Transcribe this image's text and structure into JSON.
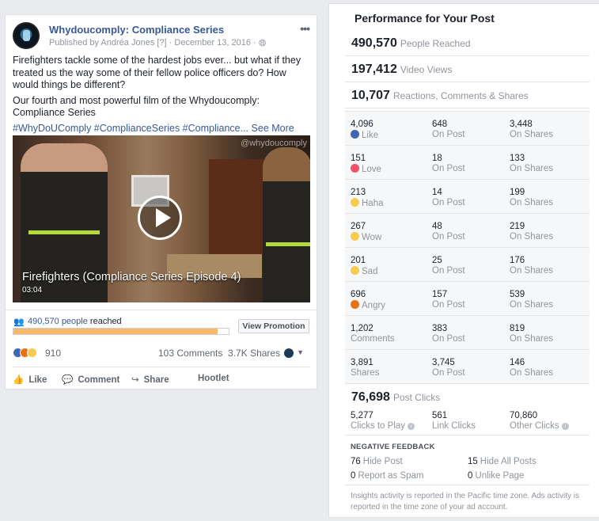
{
  "post": {
    "page_name": "Whydoucomply: Compliance Series",
    "meta": "Published by Andréa Jones [?] · December 13, 2016 · ",
    "globe_icon": "globe-icon",
    "more_icon": "•••",
    "paragraph1": "Firefighters tackle some of the hardest jobs ever... but what if they treated us the way some of their fellow police officers do? How would things be different?",
    "paragraph2": "Our fourth and most powerful film of the Whydoucomply: Compliance Series",
    "hashtags": "#WhyDoUComply #ComplianceSeries #Compliance...",
    "see_more": "See More",
    "video": {
      "watermark": "@whydoucomply",
      "title": "Firefighters (Compliance Series Episode 4)",
      "duration": "03:04"
    },
    "reach": {
      "count": "490,570 people",
      "suffix": "reached",
      "fill_fraction": 0.95,
      "button": "View Promotion"
    },
    "reaction_count": "910",
    "comments": "103 Comments",
    "shares": "3.7K Shares",
    "actions": {
      "like": "Like",
      "comment": "Comment",
      "share": "Share",
      "hootlet": "Hootlet"
    }
  },
  "panel": {
    "title": "Performance for Your Post",
    "people_reached": {
      "value": "490,570",
      "label": "People Reached"
    },
    "video_views": {
      "value": "197,412",
      "label": "Video Views"
    },
    "engagement": {
      "value": "10,707",
      "label": "Reactions, Comments & Shares"
    },
    "rows": [
      {
        "total": "4,096",
        "name": "Like",
        "icon": "like-icon",
        "color": "#4267b2",
        "post": "648",
        "shares": "3,448"
      },
      {
        "total": "151",
        "name": "Love",
        "icon": "love-icon",
        "color": "#f25268",
        "post": "18",
        "shares": "133"
      },
      {
        "total": "213",
        "name": "Haha",
        "icon": "haha-icon",
        "color": "#f7cb4d",
        "post": "14",
        "shares": "199"
      },
      {
        "total": "267",
        "name": "Wow",
        "icon": "wow-icon",
        "color": "#f7cb4d",
        "post": "48",
        "shares": "219"
      },
      {
        "total": "201",
        "name": "Sad",
        "icon": "sad-icon",
        "color": "#f7cb4d",
        "post": "25",
        "shares": "176"
      },
      {
        "total": "696",
        "name": "Angry",
        "icon": "angry-icon",
        "color": "#e9710f",
        "post": "157",
        "shares": "539"
      },
      {
        "total": "1,202",
        "name": "Comments",
        "icon": "",
        "color": "",
        "post": "383",
        "shares": "819"
      },
      {
        "total": "3,891",
        "name": "Shares",
        "icon": "",
        "color": "",
        "post": "3,745",
        "shares": "146"
      }
    ],
    "on_post_label": "On Post",
    "on_shares_label": "On Shares",
    "post_clicks": {
      "value": "76,698",
      "label": "Post Clicks"
    },
    "clicks": [
      {
        "value": "5,277",
        "label": "Clicks to Play",
        "info": true
      },
      {
        "value": "561",
        "label": "Link Clicks",
        "info": false
      },
      {
        "value": "70,860",
        "label": "Other Clicks",
        "info": true
      }
    ],
    "negative": {
      "title": "NEGATIVE FEEDBACK",
      "hide_post": {
        "value": "76",
        "label": "Hide Post"
      },
      "hide_all": {
        "value": "15",
        "label": "Hide All Posts"
      },
      "spam": {
        "value": "0",
        "label": "Report as Spam"
      },
      "unlike": {
        "value": "0",
        "label": "Unlike Page"
      }
    },
    "footnote": "Insights activity is reported in the Pacific time zone. Ads activity is reported in the time zone of your ad account."
  }
}
